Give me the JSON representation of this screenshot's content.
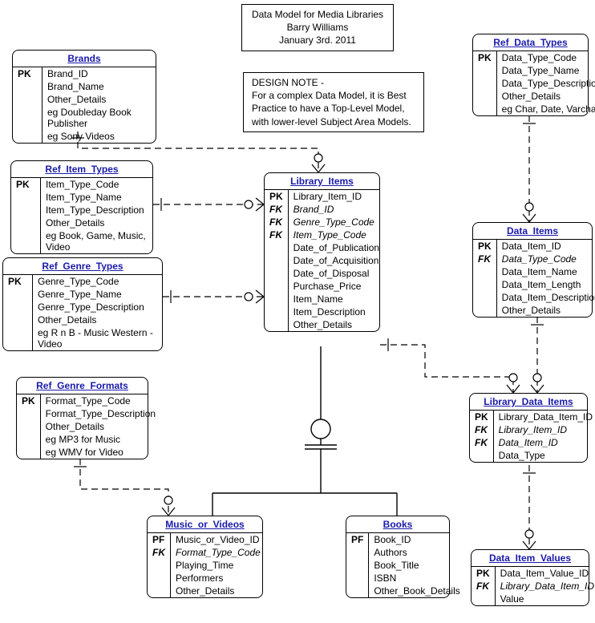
{
  "title_box": {
    "line1": "Data Model for Media Libraries",
    "line2": "Barry Williams",
    "line3": "January 3rd. 2011"
  },
  "design_note": {
    "l1": "DESIGN NOTE -",
    "l2": "For a complex Data Model, it is Best",
    "l3": "Practice to have a Top-Level Model,",
    "l4": "with lower-level Subject Area Models."
  },
  "entities": {
    "brands": {
      "name": "Brands",
      "attrs": [
        {
          "key": "PK",
          "name": "Brand_ID"
        },
        {
          "key": "",
          "name": "Brand_Name"
        },
        {
          "key": "",
          "name": "Other_Details"
        },
        {
          "key": "",
          "name": "eg Doubleday Book Publisher"
        },
        {
          "key": "",
          "name": "eg Sony Videos"
        }
      ]
    },
    "ref_data_types": {
      "name": "Ref_Data_Types",
      "attrs": [
        {
          "key": "PK",
          "name": "Data_Type_Code"
        },
        {
          "key": "",
          "name": "Data_Type_Name"
        },
        {
          "key": "",
          "name": "Data_Type_Description"
        },
        {
          "key": "",
          "name": "Other_Details"
        },
        {
          "key": "",
          "name": "eg Char, Date, Varchar"
        }
      ]
    },
    "ref_item_types": {
      "name": "Ref_Item_Types",
      "attrs": [
        {
          "key": "PK",
          "name": "Item_Type_Code"
        },
        {
          "key": "",
          "name": "Item_Type_Name"
        },
        {
          "key": "",
          "name": "Item_Type_Description"
        },
        {
          "key": "",
          "name": "Other_Details"
        },
        {
          "key": "",
          "name": "eg Book, Game, Music, Video"
        }
      ]
    },
    "library_items": {
      "name": "Library_Items",
      "attrs": [
        {
          "key": "PK",
          "name": "Library_Item_ID"
        },
        {
          "key": "FK",
          "name": "Brand_ID",
          "fk": true
        },
        {
          "key": "FK",
          "name": "Genre_Type_Code",
          "fk": true
        },
        {
          "key": "FK",
          "name": "Item_Type_Code",
          "fk": true
        },
        {
          "key": "",
          "name": "Date_of_Publication"
        },
        {
          "key": "",
          "name": "Date_of_Acquisition"
        },
        {
          "key": "",
          "name": "Date_of_Disposal"
        },
        {
          "key": "",
          "name": "Purchase_Price"
        },
        {
          "key": "",
          "name": "Item_Name"
        },
        {
          "key": "",
          "name": "Item_Description"
        },
        {
          "key": "",
          "name": "Other_Details"
        }
      ]
    },
    "data_items": {
      "name": "Data_Items",
      "attrs": [
        {
          "key": "PK",
          "name": "Data_Item_ID"
        },
        {
          "key": "FK",
          "name": "Data_Type_Code",
          "fk": true
        },
        {
          "key": "",
          "name": "Data_Item_Name"
        },
        {
          "key": "",
          "name": "Data_Item_Length"
        },
        {
          "key": "",
          "name": "Data_Item_Description"
        },
        {
          "key": "",
          "name": "Other_Details"
        }
      ]
    },
    "ref_genre_types": {
      "name": "Ref_Genre_Types",
      "attrs": [
        {
          "key": "PK",
          "name": "Genre_Type_Code"
        },
        {
          "key": "",
          "name": "Genre_Type_Name"
        },
        {
          "key": "",
          "name": "Genre_Type_Description"
        },
        {
          "key": "",
          "name": "Other_Details"
        },
        {
          "key": "",
          "name": "eg R n B - Music Western - Video"
        }
      ]
    },
    "ref_genre_formats": {
      "name": "Ref_Genre_Formats",
      "attrs": [
        {
          "key": "PK",
          "name": "Format_Type_Code"
        },
        {
          "key": "",
          "name": "Format_Type_Description"
        },
        {
          "key": "",
          "name": "Other_Details"
        },
        {
          "key": "",
          "name": "eg MP3 for Music"
        },
        {
          "key": "",
          "name": "eg WMV for Video"
        }
      ]
    },
    "library_data_items": {
      "name": "Library_Data_Items",
      "attrs": [
        {
          "key": "PK",
          "name": "Library_Data_Item_ID"
        },
        {
          "key": "FK",
          "name": "Library_Item_ID",
          "fk": true
        },
        {
          "key": "FK",
          "name": "Data_Item_ID",
          "fk": true
        },
        {
          "key": "",
          "name": "Data_Type"
        }
      ]
    },
    "music_or_videos": {
      "name": "Music_or_Videos",
      "attrs": [
        {
          "key": "PF",
          "name": "Music_or_Video_ID"
        },
        {
          "key": "FK",
          "name": "Format_Type_Code",
          "fk": true
        },
        {
          "key": "",
          "name": "Playing_Time"
        },
        {
          "key": "",
          "name": "Performers"
        },
        {
          "key": "",
          "name": "Other_Details"
        }
      ]
    },
    "books": {
      "name": "Books",
      "attrs": [
        {
          "key": "PF",
          "name": "Book_ID"
        },
        {
          "key": "",
          "name": "Authors"
        },
        {
          "key": "",
          "name": "Book_Title"
        },
        {
          "key": "",
          "name": "ISBN"
        },
        {
          "key": "",
          "name": "Other_Book_Details"
        }
      ]
    },
    "data_item_values": {
      "name": "Data_Item_Values",
      "attrs": [
        {
          "key": "PK",
          "name": "Data_Item_Value_ID"
        },
        {
          "key": "FK",
          "name": "Library_Data_Item_ID",
          "fk": true
        },
        {
          "key": "",
          "name": "Value"
        }
      ]
    }
  }
}
